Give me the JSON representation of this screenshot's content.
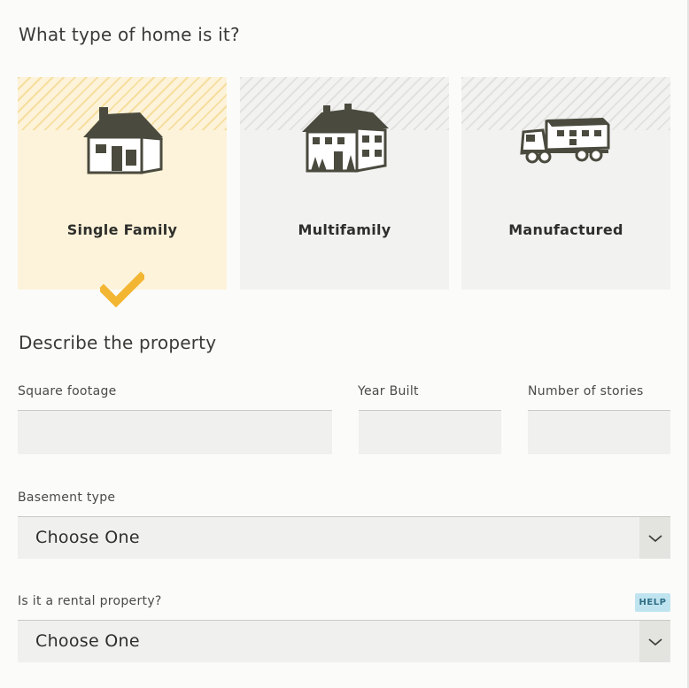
{
  "section_home_type": {
    "title": "What type of home is it?",
    "options": [
      {
        "label": "Single Family",
        "icon": "single-family-house-icon",
        "selected": true
      },
      {
        "label": "Multifamily",
        "icon": "multifamily-house-icon",
        "selected": false
      },
      {
        "label": "Manufactured",
        "icon": "manufactured-home-truck-icon",
        "selected": false
      }
    ],
    "selected_check_icon": "checkmark-icon"
  },
  "section_property": {
    "title": "Describe the property",
    "square_footage": {
      "label": "Square footage",
      "value": ""
    },
    "year_built": {
      "label": "Year Built",
      "value": ""
    },
    "stories": {
      "label": "Number of stories",
      "value": ""
    },
    "basement": {
      "label": "Basement type",
      "value": "Choose One"
    },
    "rental": {
      "label": "Is it a rental property?",
      "value": "Choose One",
      "help": "HELP"
    }
  },
  "colors": {
    "selected_card": "#fdf3da",
    "check": "#f2b632",
    "help_badge": "#bfe4ef",
    "icon": "#4a4a3e"
  }
}
